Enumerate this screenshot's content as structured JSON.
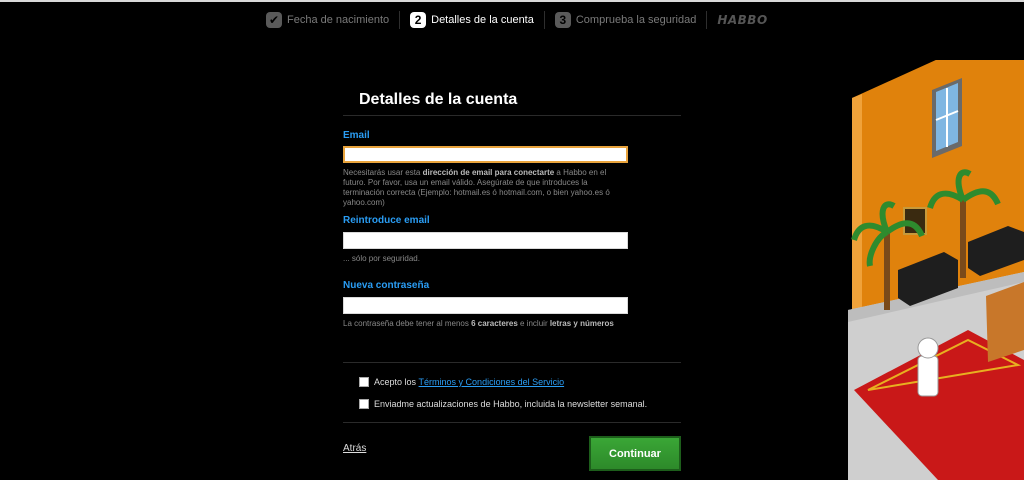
{
  "steps": [
    {
      "number": "",
      "label": "Fecha de nacimiento",
      "state": "done"
    },
    {
      "number": "2",
      "label": "Detalles de la cuenta",
      "state": "active"
    },
    {
      "number": "3",
      "label": "Comprueba la seguridad",
      "state": "pending"
    }
  ],
  "brand": "HABBO",
  "card": {
    "title": "Detalles de la cuenta",
    "email": {
      "label": "Email",
      "value": "",
      "hint_parts": [
        "Necesitarás usar esta ",
        "dirección de email para conectarte",
        " a Habbo en el futuro. Por favor, usa un email válido. Asegúrate de que introduces la terminación correcta (Ejemplo: hotmail.es ó hotmail.com, o bien yahoo.es ó yahoo.com)"
      ]
    },
    "email_confirm": {
      "label": "Reintroduce email",
      "value": "",
      "hint": "... sólo por seguridad."
    },
    "password": {
      "label": "Nueva contraseña",
      "value": "",
      "hint_parts": [
        "La contraseña debe tener al menos ",
        "6 caracteres",
        " e incluir ",
        "letras y números"
      ]
    },
    "terms": {
      "prefix": "Acepto los ",
      "link": "Términos y Condiciones del Servicio"
    },
    "newsletter": {
      "label": "Enviadme actualizaciones de Habbo, incluida la newsletter semanal."
    },
    "back_label": "Atrás",
    "continue_label": "Continuar"
  },
  "colors": {
    "accent": "#2a9df4",
    "focus": "#e8a33c",
    "button": "#2d8a2a"
  }
}
